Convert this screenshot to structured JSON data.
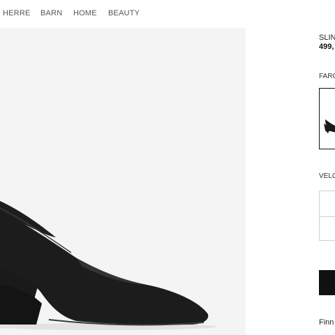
{
  "nav": {
    "items": [
      {
        "label": "HERRE"
      },
      {
        "label": "BARN"
      },
      {
        "label": "HOME"
      },
      {
        "label": "BEAUTY"
      }
    ]
  },
  "product": {
    "name": "SLIN",
    "price": "499,",
    "color_label": "FARG",
    "size_label": "VELG",
    "find_link": "Finn"
  },
  "colors": {
    "shoe": "#1b1b1b",
    "image_bg": "#f4f4f4",
    "button": "#111111"
  }
}
